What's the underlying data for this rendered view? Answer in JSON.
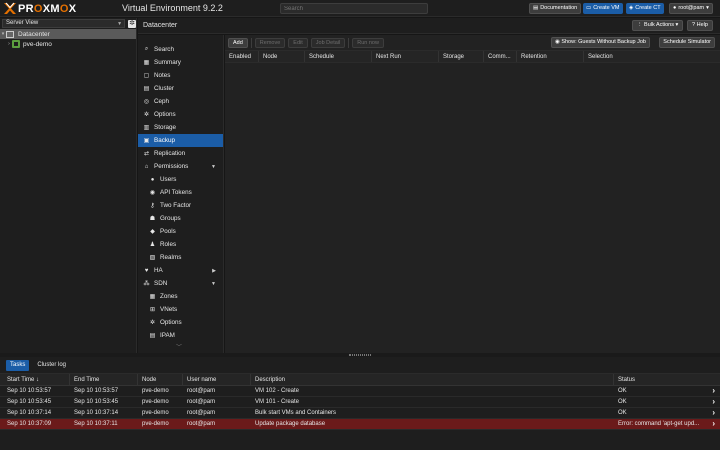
{
  "topbar": {
    "logo_left": "PR",
    "logo_o1": "O",
    "logo_mid": "XM",
    "logo_o2": "O",
    "logo_right": "X",
    "version": "Virtual Environment 9.2.2",
    "search_placeholder": "Search",
    "buttons": {
      "documentation": "Documentation",
      "create_vm": "Create VM",
      "create_ct": "Create CT",
      "user": "root@pam",
      "help": "Help"
    }
  },
  "tree": {
    "view": "Server View",
    "items": [
      {
        "label": "Datacenter"
      },
      {
        "label": "pve-demo"
      }
    ]
  },
  "content_header": {
    "title": "Datacenter",
    "bulk_actions": "Bulk Actions",
    "help": "Help"
  },
  "nav": {
    "items": [
      {
        "label": "Search"
      },
      {
        "label": "Summary"
      },
      {
        "label": "Notes"
      },
      {
        "label": "Cluster"
      },
      {
        "label": "Ceph"
      },
      {
        "label": "Options"
      },
      {
        "label": "Storage"
      },
      {
        "label": "Backup"
      },
      {
        "label": "Replication"
      },
      {
        "label": "Permissions"
      },
      {
        "label": "Users"
      },
      {
        "label": "API Tokens"
      },
      {
        "label": "Two Factor"
      },
      {
        "label": "Groups"
      },
      {
        "label": "Pools"
      },
      {
        "label": "Roles"
      },
      {
        "label": "Realms"
      },
      {
        "label": "HA"
      },
      {
        "label": "SDN"
      },
      {
        "label": "Zones"
      },
      {
        "label": "VNets"
      },
      {
        "label": "Options"
      },
      {
        "label": "IPAM"
      }
    ]
  },
  "backup": {
    "toolbar": {
      "add": "Add",
      "remove": "Remove",
      "edit": "Edit",
      "job_detail": "Job Detail",
      "run_now": "Run now",
      "show_guests": "Show: Guests Without Backup Job",
      "schedule_simulator": "Schedule Simulator"
    },
    "columns": [
      "Enabled",
      "Node",
      "Schedule",
      "Next Run",
      "Storage",
      "Comm...",
      "Retention",
      "Selection"
    ]
  },
  "log": {
    "tabs": [
      "Tasks",
      "Cluster log"
    ],
    "columns": {
      "start": "Start Time",
      "end": "End Time",
      "node": "Node",
      "user": "User name",
      "desc": "Description",
      "status": "Status"
    },
    "rows": [
      {
        "start": "Sep 10 10:53:57",
        "end": "Sep 10 10:53:57",
        "node": "pve-demo",
        "user": "root@pam",
        "desc": "VM 102 - Create",
        "status": "OK"
      },
      {
        "start": "Sep 10 10:53:45",
        "end": "Sep 10 10:53:45",
        "node": "pve-demo",
        "user": "root@pam",
        "desc": "VM 101 - Create",
        "status": "OK"
      },
      {
        "start": "Sep 10 10:37:14",
        "end": "Sep 10 10:37:14",
        "node": "pve-demo",
        "user": "root@pam",
        "desc": "Bulk start VMs and Containers",
        "status": "OK"
      },
      {
        "start": "Sep 10 10:37:09",
        "end": "Sep 10 10:37:11",
        "node": "pve-demo",
        "user": "root@pam",
        "desc": "Update package database",
        "status": "Error: command 'apt-get upd..."
      }
    ]
  },
  "colors": {
    "accent": "#1b5da7",
    "brand_orange": "#e57000",
    "error_row": "#6b1a1a"
  }
}
